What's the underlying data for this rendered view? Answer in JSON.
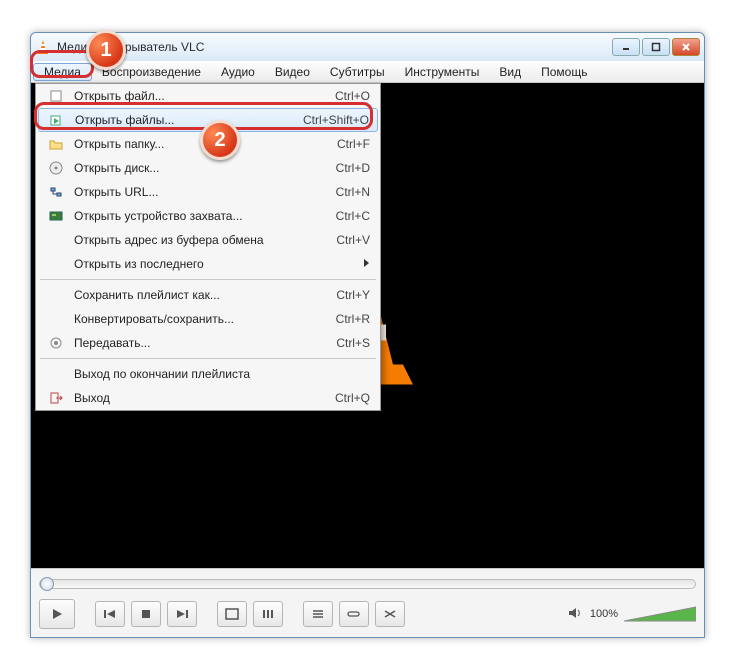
{
  "title": "Медиапроигрыватель VLC",
  "menus": [
    "Медиа",
    "Воспроизведение",
    "Аудио",
    "Видео",
    "Субтитры",
    "Инструменты",
    "Вид",
    "Помощь"
  ],
  "dropdown": {
    "items": [
      {
        "icon": "file",
        "label": "Открыть файл...",
        "shortcut": "Ctrl+O"
      },
      {
        "icon": "files",
        "label": "Открыть файлы...",
        "shortcut": "Ctrl+Shift+O",
        "hi": true
      },
      {
        "icon": "folder",
        "label": "Открыть папку...",
        "shortcut": "Ctrl+F"
      },
      {
        "icon": "disc",
        "label": "Открыть диск...",
        "shortcut": "Ctrl+D"
      },
      {
        "icon": "net",
        "label": "Открыть URL...",
        "shortcut": "Ctrl+N"
      },
      {
        "icon": "card",
        "label": "Открыть устройство захвата...",
        "shortcut": "Ctrl+C"
      },
      {
        "icon": "",
        "label": "Открыть адрес из буфера обмена",
        "shortcut": "Ctrl+V"
      },
      {
        "icon": "",
        "label": "Открыть из последнего",
        "sub": true
      },
      {
        "sep": true
      },
      {
        "icon": "",
        "label": "Сохранить плейлист как...",
        "shortcut": "Ctrl+Y"
      },
      {
        "icon": "",
        "label": "Конвертировать/сохранить...",
        "shortcut": "Ctrl+R"
      },
      {
        "icon": "stream",
        "label": "Передавать...",
        "shortcut": "Ctrl+S"
      },
      {
        "sep": true
      },
      {
        "icon": "",
        "label": "Выход по окончании плейлиста"
      },
      {
        "icon": "exit",
        "label": "Выход",
        "shortcut": "Ctrl+Q"
      }
    ]
  },
  "volume": "100%",
  "badges": [
    "1",
    "2"
  ]
}
